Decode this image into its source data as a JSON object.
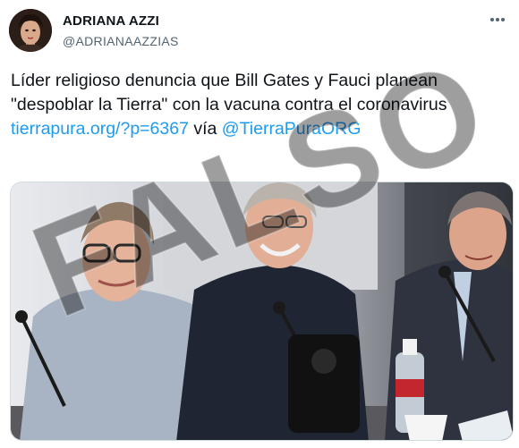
{
  "author": {
    "display_name": "ADRIANA AZZI",
    "handle": "@ADRIANAAZZIAS"
  },
  "tweet": {
    "text_part1": "Líder religioso denuncia que Bill Gates y Fauci planean \"despoblar la Tierra\" con la vacuna contra el coronavirus ",
    "link": "tierrapura.org/?p=6367",
    "text_part2": " vía ",
    "mention": "@TierraPuraORG"
  },
  "watermark": {
    "text": "FALSO"
  },
  "icons": {
    "more": "more-horizontal-icon"
  },
  "colors": {
    "link": "#1d9bf0",
    "handle": "#536471",
    "watermark": "#000000"
  }
}
